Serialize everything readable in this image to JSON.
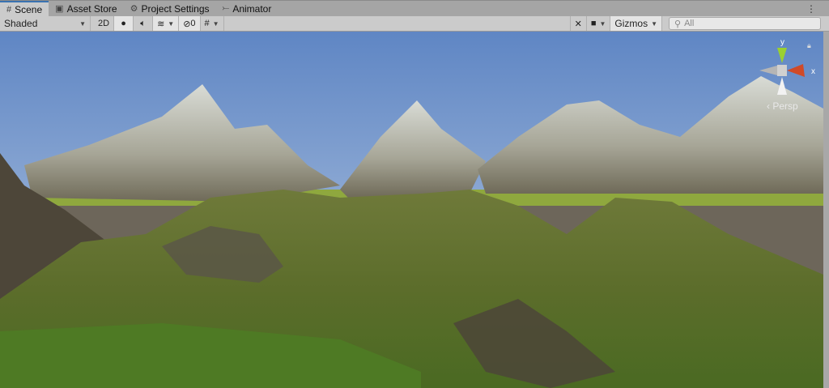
{
  "tabs": [
    {
      "label": "Scene",
      "icon": "grid-icon",
      "active": true
    },
    {
      "label": "Asset Store",
      "icon": "bag-icon"
    },
    {
      "label": "Project Settings",
      "icon": "gear-icon"
    },
    {
      "label": "Animator",
      "icon": "animator-icon"
    }
  ],
  "toolbar": {
    "shading_mode": "Shaded",
    "mode_2d": "2D",
    "hidden_count": "0",
    "gizmos": "Gizmos",
    "search_placeholder": "All"
  },
  "scene": {
    "axis_y": "y",
    "axis_x": "x",
    "projection": "Persp"
  },
  "colors": {
    "sky_top": "#5f86c4",
    "sky_horizon": "#a9c2df",
    "grass": "#5e7a2c",
    "active_tab_accent": "#3a72b0"
  }
}
